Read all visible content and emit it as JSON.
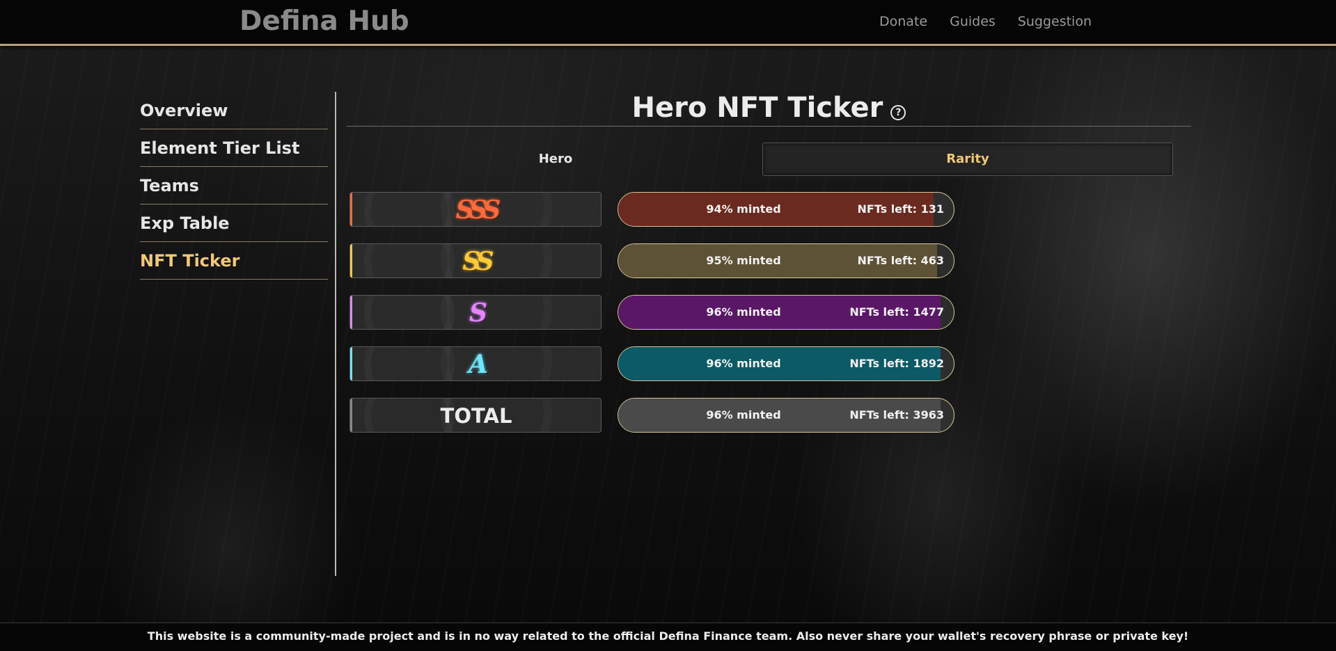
{
  "header": {
    "brand": "Defina Hub",
    "nav": [
      "Donate",
      "Guides",
      "Suggestion"
    ]
  },
  "sidebar": {
    "items": [
      {
        "label": "Overview",
        "active": false
      },
      {
        "label": "Element Tier List",
        "active": false
      },
      {
        "label": "Teams",
        "active": false
      },
      {
        "label": "Exp Table",
        "active": false
      },
      {
        "label": "NFT Ticker",
        "active": true
      }
    ]
  },
  "main": {
    "title": "Hero NFT Ticker",
    "help_icon": "?",
    "columns": {
      "hero": "Hero",
      "rarity": "Rarity"
    },
    "rows": [
      {
        "rank": "SSS",
        "minted_label": "94% minted",
        "minted_fraction": 0.94,
        "left_label": "NFTs left: 131",
        "color": "#ff6a3c",
        "fill": "#6a2a1f"
      },
      {
        "rank": "SS",
        "minted_label": "95% minted",
        "minted_fraction": 0.95,
        "left_label": "NFTs left: 463",
        "color": "#ffc93a",
        "fill": "#5e5236"
      },
      {
        "rank": "S",
        "minted_label": "96% minted",
        "minted_fraction": 0.96,
        "left_label": "NFTs left: 1477",
        "color": "#e386ff",
        "fill": "#5a1766"
      },
      {
        "rank": "A",
        "minted_label": "96% minted",
        "minted_fraction": 0.96,
        "left_label": "NFTs left: 1892",
        "color": "#6fe6ff",
        "fill": "#0b5a66"
      },
      {
        "rank": "TOTAL",
        "minted_label": "96% minted",
        "minted_fraction": 0.96,
        "left_label": "NFTs left: 3963",
        "color": "#888888",
        "fill": "#4a4a4a"
      }
    ]
  },
  "footer": {
    "text": "This website is a community-made project and is in no way related to the official Defina Finance team. Also never share your wallet's recovery phrase or private key!"
  },
  "colors": {
    "accent": "#f0c879",
    "header_border": "#b9a27a"
  }
}
